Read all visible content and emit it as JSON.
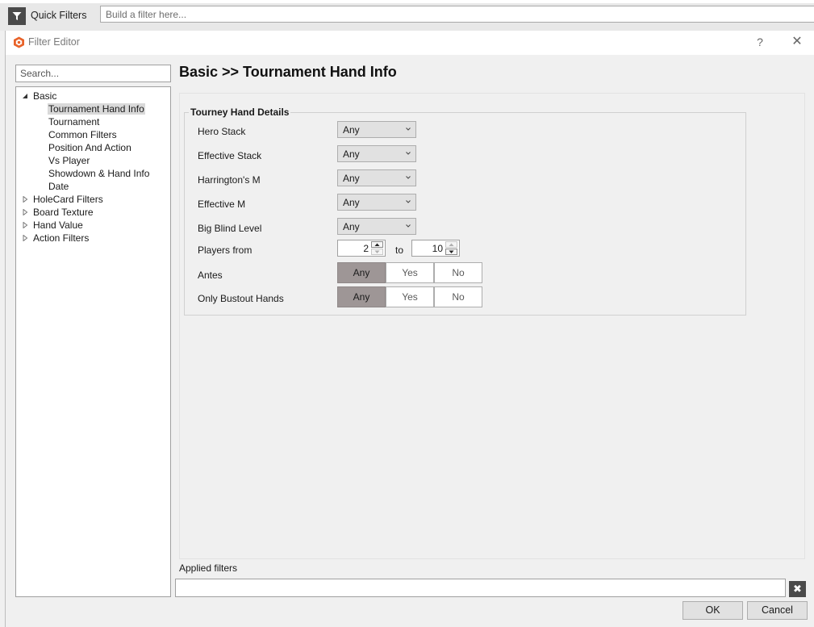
{
  "quick_filters": {
    "label": "Quick Filters",
    "placeholder": "Build a filter here..."
  },
  "dialog": {
    "title": "Filter Editor",
    "help_label": "?",
    "close_label": "✕"
  },
  "search": {
    "placeholder": "Search..."
  },
  "tree": {
    "basic": {
      "label": "Basic",
      "children": [
        "Tournament Hand Info",
        "Tournament",
        "Common Filters",
        "Position And Action",
        "Vs Player",
        "Showdown & Hand Info",
        "Date"
      ]
    },
    "collapsed": [
      "HoleCard Filters",
      "Board Texture",
      "Hand Value",
      "Action Filters"
    ],
    "selected": "Tournament Hand Info"
  },
  "page_title": "Basic >> Tournament Hand Info",
  "group": {
    "title": "Tourney Hand Details",
    "rows": {
      "hero_stack": {
        "label": "Hero Stack",
        "value": "Any"
      },
      "effective_stack": {
        "label": "Effective Stack",
        "value": "Any"
      },
      "harringtons_m": {
        "label": "Harrington's M",
        "value": "Any"
      },
      "effective_m": {
        "label": "Effective M",
        "value": "Any"
      },
      "big_blind_level": {
        "label": "Big Blind Level",
        "value": "Any"
      },
      "players_from": {
        "label": "Players from",
        "from": "2",
        "to_label": "to",
        "to": "10"
      },
      "antes": {
        "label": "Antes",
        "options": [
          "Any",
          "Yes",
          "No"
        ],
        "selected": "Any"
      },
      "only_bustout": {
        "label": "Only Bustout Hands",
        "options": [
          "Any",
          "Yes",
          "No"
        ],
        "selected": "Any"
      }
    }
  },
  "applied_filters": {
    "label": "Applied filters",
    "clear_label": "✖"
  },
  "buttons": {
    "ok": "OK",
    "cancel": "Cancel"
  }
}
